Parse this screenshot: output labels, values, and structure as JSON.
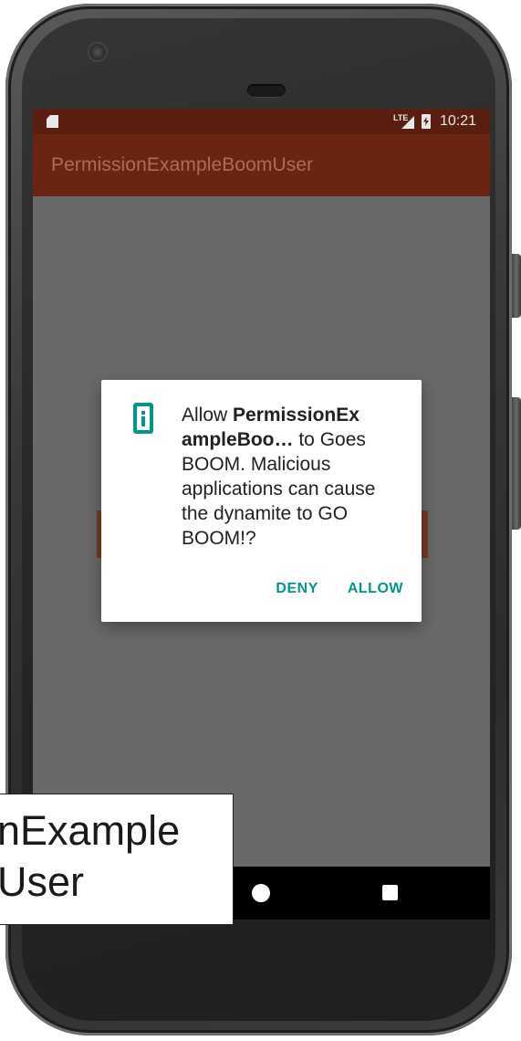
{
  "status_bar": {
    "sd_card_icon": "sd-card-icon",
    "network_label": "LTE",
    "signal_icon": "cell-signal-icon",
    "battery_icon": "battery-charging-icon",
    "time": "10:21"
  },
  "app_bar": {
    "title": "PermissionExampleBoomUser"
  },
  "dialog": {
    "icon": "permission-info-icon",
    "message_prefix": "Allow ",
    "app_name_line1": "PermissionEx",
    "app_name_line2": "ampleBoo…",
    "message_suffix": " to Goes BOOM. Malicious applications can cause the dynamite to GO BOOM!?",
    "deny_label": "DENY",
    "allow_label": "ALLOW"
  },
  "nav_bar": {
    "home_icon": "home-icon",
    "recents_icon": "recents-icon"
  },
  "overlay_label": {
    "line1": "nExample",
    "line2": "User"
  },
  "colors": {
    "status_bar": "#5a1e10",
    "app_bar": "#6a2412",
    "screen_dim": "#696969",
    "accent": "#00968a"
  }
}
